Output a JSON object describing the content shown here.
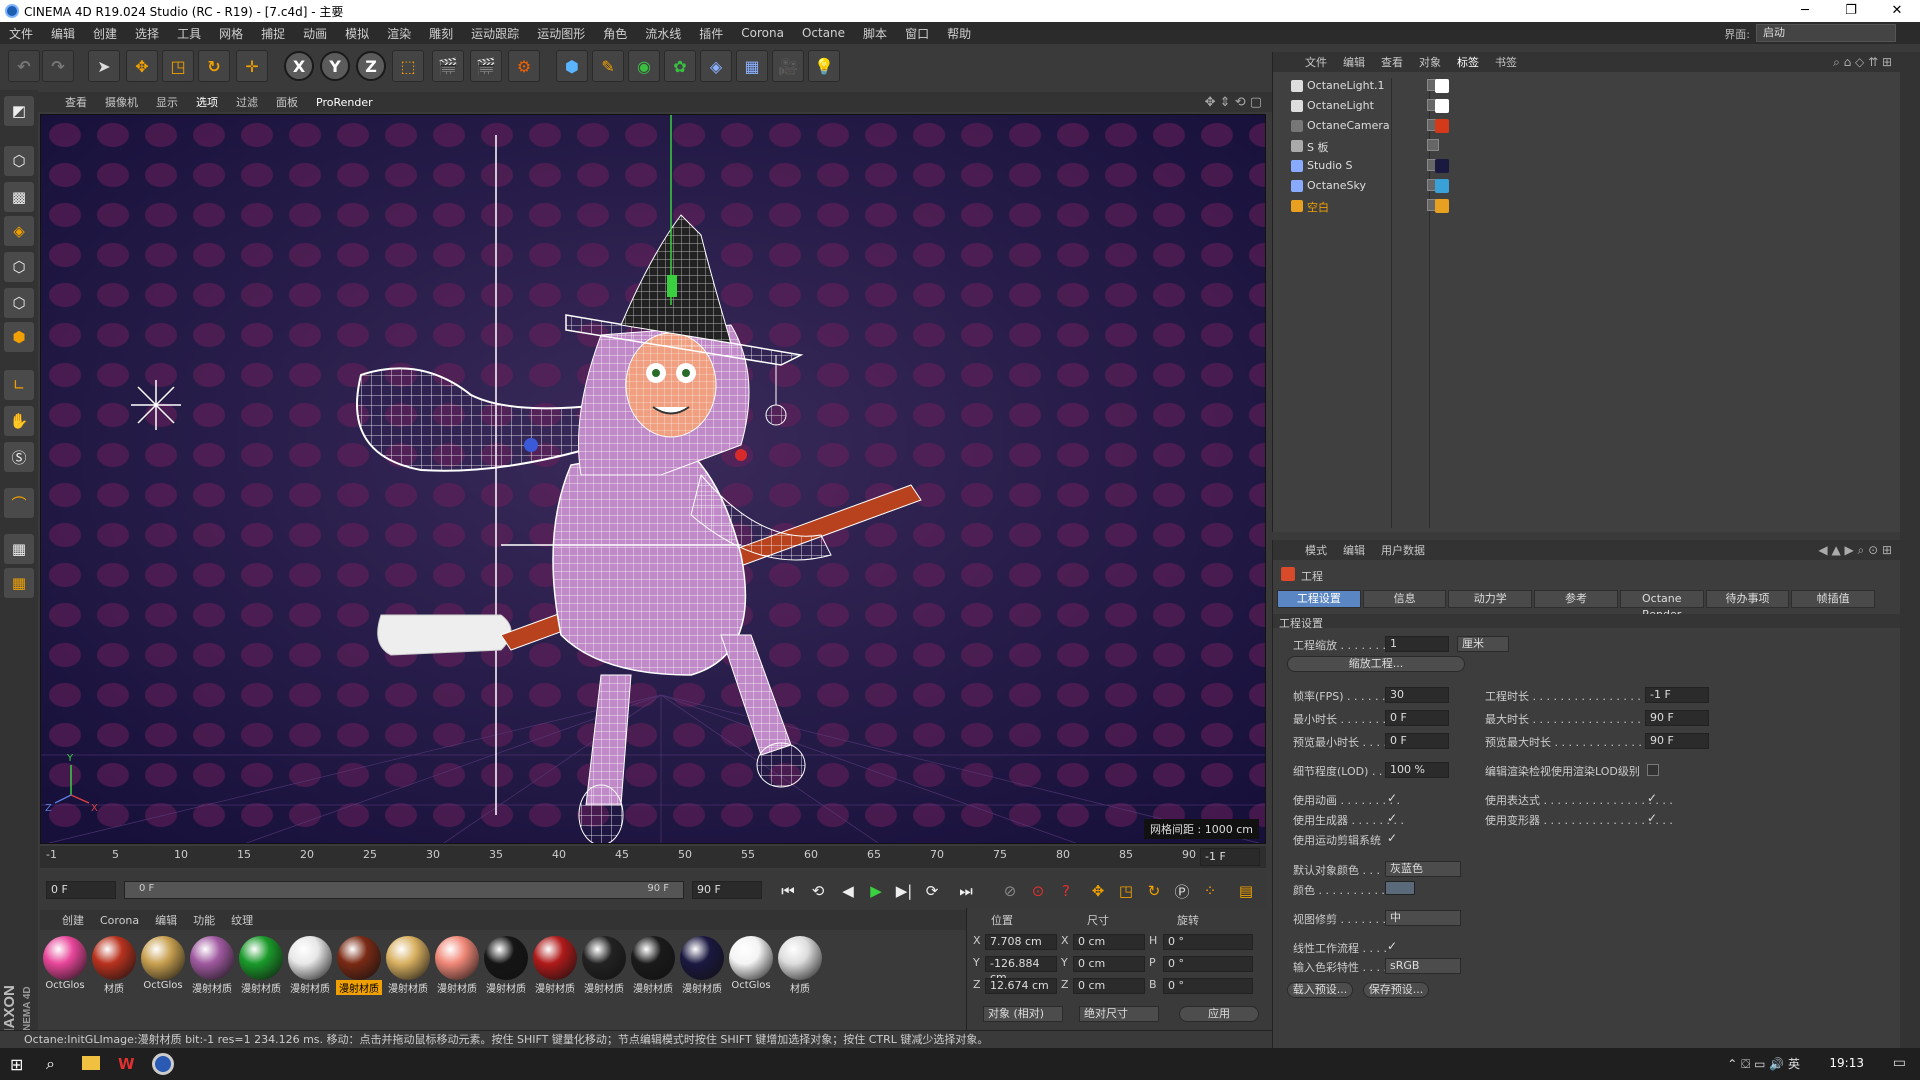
{
  "window": {
    "title": "CINEMA 4D R19.024 Studio (RC - R19) - [7.c4d] - 主要",
    "minimize": "─",
    "maximize": "❐",
    "close": "✕"
  },
  "menu": {
    "items": [
      "文件",
      "编辑",
      "创建",
      "选择",
      "工具",
      "网格",
      "捕捉",
      "动画",
      "模拟",
      "渲染",
      "雕刻",
      "运动跟踪",
      "运动图形",
      "角色",
      "流水线",
      "插件",
      "Corona",
      "Octane",
      "脚本",
      "窗口",
      "帮助"
    ],
    "layout_label": "界面:",
    "layout_value": "启动"
  },
  "toolbar": {
    "axis_x": "X",
    "axis_y": "Y",
    "axis_z": "Z"
  },
  "viewport": {
    "menu": [
      "查看",
      "摄像机",
      "显示",
      "选项",
      "过滤",
      "面板",
      "ProRender"
    ],
    "grid_info": "网格间距 : 1000 cm",
    "axis_labels": {
      "x": "X",
      "y": "Y",
      "z": "Z"
    }
  },
  "timeline": {
    "ticks": [
      "-1",
      "5",
      "10",
      "15",
      "20",
      "25",
      "30",
      "35",
      "40",
      "45",
      "50",
      "55",
      "60",
      "65",
      "70",
      "75",
      "80",
      "85",
      "90"
    ],
    "end_field": "-1 F",
    "start_frame": "0 F",
    "slider_start": "0 F",
    "slider_end": "90 F",
    "end_frame": "90 F"
  },
  "materials": {
    "menu": [
      "创建",
      "Corona",
      "编辑",
      "功能",
      "纹理"
    ],
    "items": [
      {
        "label": "OctGlos",
        "color": "#e8469a"
      },
      {
        "label": "材质",
        "color": "#b8321e"
      },
      {
        "label": "OctGlos",
        "color": "#c8a050"
      },
      {
        "label": "漫射材质",
        "color": "#a05aa0"
      },
      {
        "label": "漫射材质",
        "color": "#1a9a2a"
      },
      {
        "label": "漫射材质",
        "color": "#e8e8e8"
      },
      {
        "label": "漫射材质",
        "color": "#7a2a14"
      },
      {
        "label": "漫射材质",
        "color": "#d8b060"
      },
      {
        "label": "漫射材质",
        "color": "#f08878"
      },
      {
        "label": "漫射材质",
        "color": "#151515"
      },
      {
        "label": "漫射材质",
        "color": "#b01a1a"
      },
      {
        "label": "漫射材质",
        "color": "#222222"
      },
      {
        "label": "漫射材质",
        "color": "#1a1a1a"
      },
      {
        "label": "漫射材质",
        "color": "#1a1840"
      },
      {
        "label": "OctGlos",
        "color": "#f4f4f4"
      },
      {
        "label": "材质",
        "color": "#dddddd"
      }
    ],
    "selected_index": 6
  },
  "coords": {
    "headers": {
      "pos": "位置",
      "size": "尺寸",
      "rot": "旋转"
    },
    "rows": [
      {
        "axis": "X",
        "pos": "7.708 cm",
        "saxis": "X",
        "size": "0 cm",
        "raxis": "H",
        "rot": "0 °"
      },
      {
        "axis": "Y",
        "pos": "-126.884 cm",
        "saxis": "Y",
        "size": "0 cm",
        "raxis": "P",
        "rot": "0 °"
      },
      {
        "axis": "Z",
        "pos": "12.674 cm",
        "saxis": "Z",
        "size": "0 cm",
        "raxis": "B",
        "rot": "0 °"
      }
    ],
    "mode": "对象 (相对)",
    "size_mode": "绝对尺寸",
    "apply": "应用"
  },
  "status": "Octane:InitGLImage:漫射材质 bit:-1 res=1  234.126 ms.   移动：点击并拖动鼠标移动元素。按住 SHIFT 键量化移动；节点编辑模式时按住 SHIFT 键增加选择对象；按住 CTRL 键减少选择对象。",
  "objects": {
    "menu": [
      "文件",
      "编辑",
      "查看",
      "对象",
      "标签",
      "书签"
    ],
    "rows": [
      {
        "name": "OctaneLight.1",
        "color": "#dddddd",
        "tag": "#ffffff"
      },
      {
        "name": "OctaneLight",
        "color": "#dddddd",
        "tag": "#ffffff"
      },
      {
        "name": "OctaneCamera",
        "color": "#777777",
        "tag": "#d43a1a"
      },
      {
        "name": "S 板",
        "color": "#aaaaaa",
        "tag": ""
      },
      {
        "name": "Studio S",
        "color": "#88aaff",
        "tag": "#1a1a40"
      },
      {
        "name": "OctaneSky",
        "color": "#88aaff",
        "tag": "#3aa0d8"
      },
      {
        "name": "空白",
        "color": "#e8a020",
        "tag": "#e8a020"
      }
    ]
  },
  "attributes": {
    "menu": [
      "模式",
      "编辑",
      "用户数据"
    ],
    "section_icon_label": "工程",
    "tabs": [
      "工程设置",
      "信息",
      "动力学",
      "参考",
      "Octane Render",
      "待办事项",
      "帧插值"
    ],
    "section": "工程设置",
    "scale_label": "工程缩放 . . . . . . . . .",
    "scale_value": "1",
    "scale_unit": "厘米",
    "scale_button": "缩放工程...",
    "fps_label": "帧率(FPS) . . . . . . . .",
    "fps_value": "30",
    "duration_label": "工程时长 . . . . . . . . . . . . . . . . . . . .",
    "duration_value": "-1 F",
    "min_label": "最小时长 . . . . . . . . .",
    "min_value": "0 F",
    "max_label": "最大时长 . . . . . . . . . . . . . . . . . . . .",
    "max_value": "90 F",
    "pmin_label": "预览最小时长 . . . .",
    "pmin_value": "0 F",
    "pmax_label": "预览最大时长 . . . . . . . . . . . . . . . .",
    "pmax_value": "90 F",
    "lod_label": "细节程度(LOD) . . . .",
    "lod_value": "100 %",
    "lod_render_label": "编辑渲染检视使用渲染LOD级别",
    "anim_label": "使用动画 . . . . . . . . .",
    "expr_label": "使用表达式 . . . . . . . . . . . . . . . . . . .",
    "gen_label": "使用生成器 . . . . . . . .",
    "deform_label": "使用变形器 . . . . . . . . . . . . . . . . . . .",
    "mograph_label": "使用运动剪辑系统",
    "color_default_label": "默认对象颜色 . . .",
    "color_default_value": "灰蓝色",
    "color_label": "颜色 . . . . . . . . . . . .",
    "clip_label": "视图修剪 . . . . . . . . .",
    "clip_value": "中",
    "linear_label": "线性工作流程 . . . .",
    "input_color_label": "输入色彩特性 . . . .",
    "input_color_value": "sRGB",
    "load_preset": "载入预设...",
    "save_preset": "保存预设..."
  },
  "taskbar": {
    "clock": "19:13"
  }
}
